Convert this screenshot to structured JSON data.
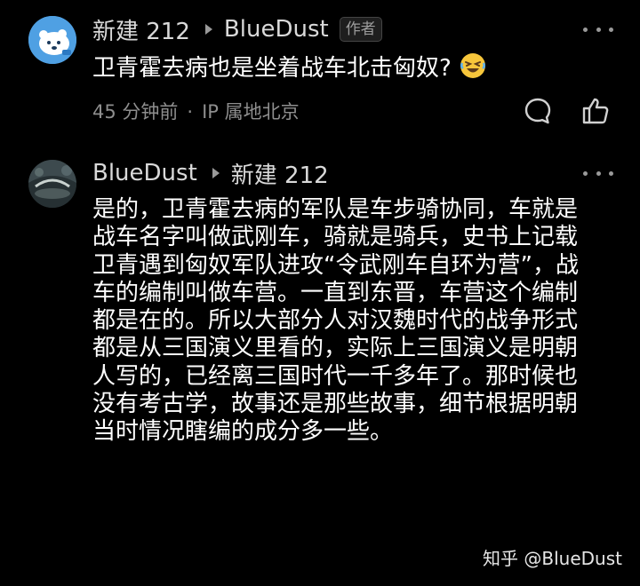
{
  "comment_top": {
    "author": "新建 212",
    "reply_to": "BlueDust",
    "badge": "作者",
    "text": "卫青霍去病也是坐着战车北击匈奴?",
    "emoji": "rofl-emoji",
    "time": "45 分钟前",
    "separator": "·",
    "ip": "IP 属地北京"
  },
  "comment_reply": {
    "author": "BlueDust",
    "reply_to": "新建 212",
    "text": "是的，卫青霍去病的军队是车步骑协同，车就是战车名字叫做武刚车，骑就是骑兵，史书上记载卫青遇到匈奴军队进攻“令武刚车自环为营”，战车的编制叫做车营。一直到东晋，车营这个编制都是在的。所以大部分人对汉魏时代的战争形式都是从三国演义里看的，实际上三国演义是明朝人写的，已经离三国时代一千多年了。那时候也没有考古学，故事还是那些故事，细节根据明朝当时情况瞎编的成分多一些。"
  },
  "watermark": "知乎 @BlueDust",
  "icons": {
    "reply": "comment-bubble-icon",
    "like": "thumbs-up-icon",
    "more": "more-dots-icon",
    "arrow": "reply-arrow-icon"
  },
  "colors": {
    "background": "#000000",
    "text": "#ffffff",
    "secondary": "#8e8e8e",
    "avatar_blue": "#4fa0e3"
  }
}
